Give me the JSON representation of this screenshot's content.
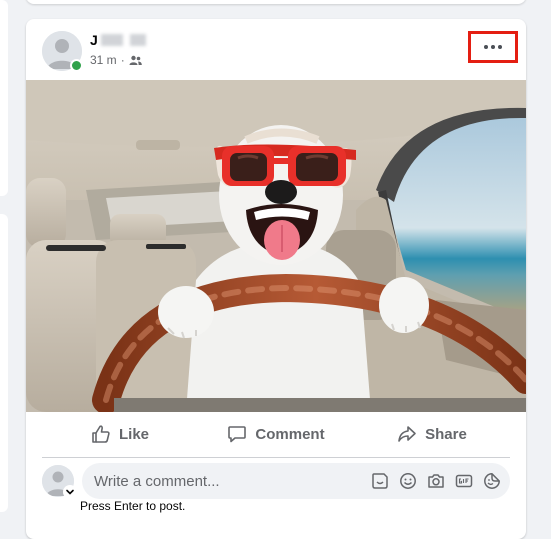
{
  "post": {
    "author_name_initial": "J",
    "timestamp": "31 m",
    "separator": "·",
    "audience_icon": "friends-icon",
    "more_label": "···"
  },
  "photo": {
    "subject": "dog-driving-car",
    "accent_color": "#e8302a"
  },
  "actions": {
    "like_label": "Like",
    "comment_label": "Comment",
    "share_label": "Share"
  },
  "comment": {
    "placeholder": "Write a comment...",
    "hint": "Press Enter to post.",
    "icons": [
      "sticker-icon",
      "emoji-icon",
      "camera-icon",
      "gif-icon",
      "sticker-smile-icon"
    ]
  },
  "colors": {
    "highlight_border": "#e41e12",
    "online": "#31a24c",
    "muted_text": "#65676b"
  }
}
